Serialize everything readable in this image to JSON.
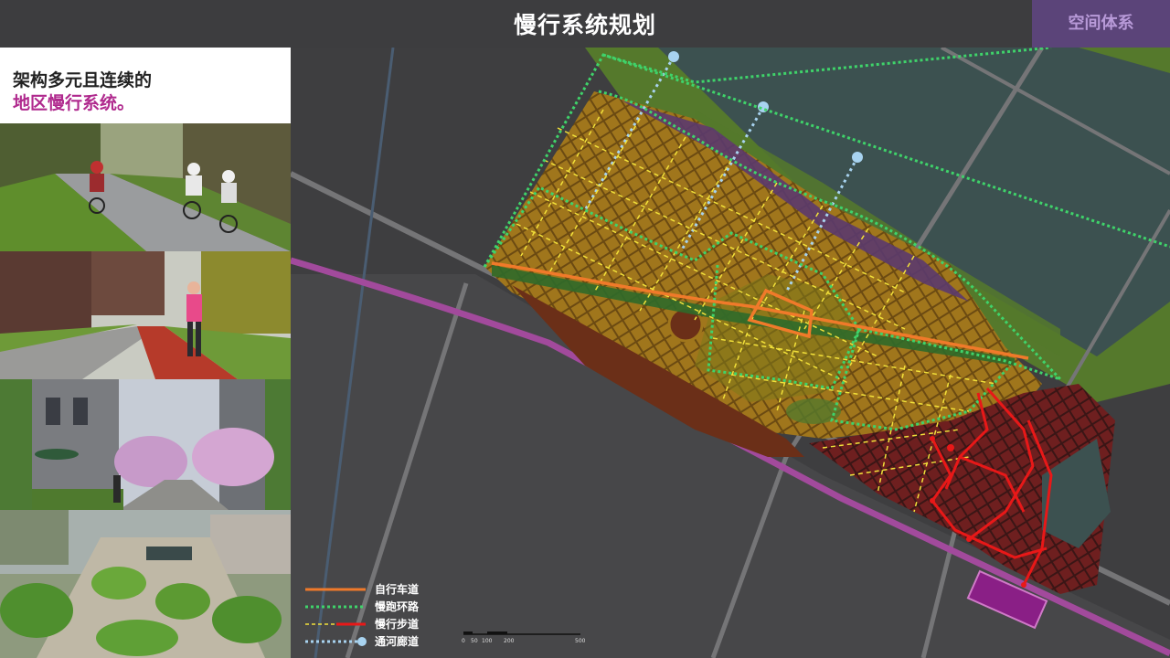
{
  "header": {
    "title": "慢行系统规划",
    "section_tag": "空间体系"
  },
  "intro": {
    "line1": "架构多元且连续的",
    "line2": "地区慢行系统。"
  },
  "photos": [
    {
      "subject": "cyclists on a greenway path"
    },
    {
      "subject": "jogger on a red running track"
    },
    {
      "subject": "pedestrian street with flowering trees"
    },
    {
      "subject": "landscaped pedestrian plaza"
    }
  ],
  "legend": [
    {
      "label": "自行车道",
      "color": "#f07a2a"
    },
    {
      "label": "慢跑环路",
      "color": "#3fd36a"
    },
    {
      "label": "慢行步道",
      "color": "#f2e13a"
    },
    {
      "label": "通河廊道",
      "color": "#a8d3f0"
    }
  ],
  "scale": {
    "ticks": [
      "0",
      "50",
      "100",
      "200",
      "500"
    ]
  },
  "colors": {
    "accent": "#b02a8e",
    "metro": "#a24a9c",
    "station": "#8a1f86",
    "river": "#3c5150",
    "riverbank": "#55792c",
    "block": "#7a4f12",
    "walkway": "#e81818",
    "bike": "#f07a2a",
    "jog": "#3fd36a"
  }
}
